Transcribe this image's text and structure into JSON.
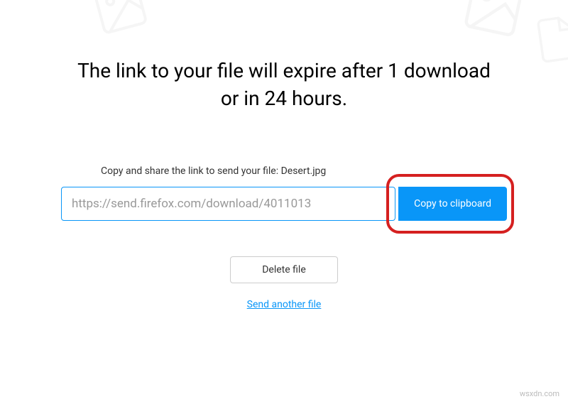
{
  "heading": "The link to your file will expire after 1 download or in 24 hours.",
  "instruction": "Copy and share the link to send your file: Desert.jpg",
  "link_url": "https://send.firefox.com/download/4011013",
  "copy_button_label": "Copy to clipboard",
  "delete_button_label": "Delete file",
  "send_another_label": "Send another file",
  "watermark": "wsxdn.com"
}
